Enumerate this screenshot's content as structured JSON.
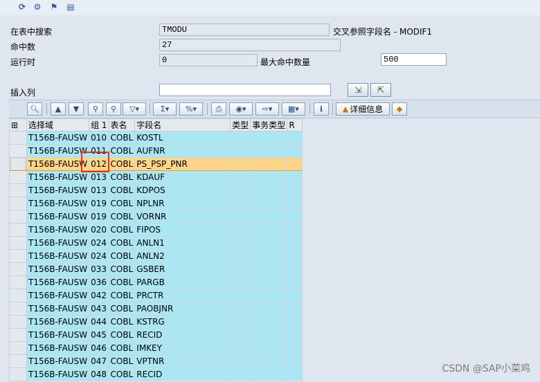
{
  "toolbar_icons": [
    "refresh-icon",
    "settings-icon",
    "flag-icon",
    "document-icon"
  ],
  "form": {
    "search_table_label": "在表中搜索",
    "search_table_value": "TMODU",
    "cross_ref_label": "交叉参照字段名 - MODIF1",
    "hits_label": "命中数",
    "hits_value": "27",
    "runtime_label": "运行时",
    "runtime_value": "0",
    "max_hits_label": "最大命中数量",
    "max_hits_value": "500",
    "insert_col_label": "插入列",
    "insert_col_value": ""
  },
  "alv_toolbar": {
    "details_label": "详细信息"
  },
  "grid": {
    "headers": [
      "选择域",
      "组 1",
      "表名",
      "字段名",
      "类型",
      "事务类型",
      "R"
    ],
    "rows": [
      [
        "T156B-FAUSW",
        "010",
        "COBL",
        "KOSTL"
      ],
      [
        "T156B-FAUSW",
        "011",
        "COBL",
        "AUFNR"
      ],
      [
        "T156B-FAUSW",
        "012",
        "COBL",
        "PS_PSP_PNR"
      ],
      [
        "T156B-FAUSW",
        "013",
        "COBL",
        "KDAUF"
      ],
      [
        "T156B-FAUSW",
        "013",
        "COBL",
        "KDPOS"
      ],
      [
        "T156B-FAUSW",
        "019",
        "COBL",
        "NPLNR"
      ],
      [
        "T156B-FAUSW",
        "019",
        "COBL",
        "VORNR"
      ],
      [
        "T156B-FAUSW",
        "020",
        "COBL",
        "FIPOS"
      ],
      [
        "T156B-FAUSW",
        "024",
        "COBL",
        "ANLN1"
      ],
      [
        "T156B-FAUSW",
        "024",
        "COBL",
        "ANLN2"
      ],
      [
        "T156B-FAUSW",
        "033",
        "COBL",
        "GSBER"
      ],
      [
        "T156B-FAUSW",
        "036",
        "COBL",
        "PARGB"
      ],
      [
        "T156B-FAUSW",
        "042",
        "COBL",
        "PRCTR"
      ],
      [
        "T156B-FAUSW",
        "043",
        "COBL",
        "PAOBJNR"
      ],
      [
        "T156B-FAUSW",
        "044",
        "COBL",
        "KSTRG"
      ],
      [
        "T156B-FAUSW",
        "045",
        "COBL",
        "RECID"
      ],
      [
        "T156B-FAUSW",
        "046",
        "COBL",
        "IMKEY"
      ],
      [
        "T156B-FAUSW",
        "047",
        "COBL",
        "VPTNR"
      ],
      [
        "T156B-FAUSW",
        "048",
        "COBL",
        "RECID"
      ]
    ],
    "highlighted_row": 2
  },
  "watermark": "CSDN @SAP小菜鸡"
}
